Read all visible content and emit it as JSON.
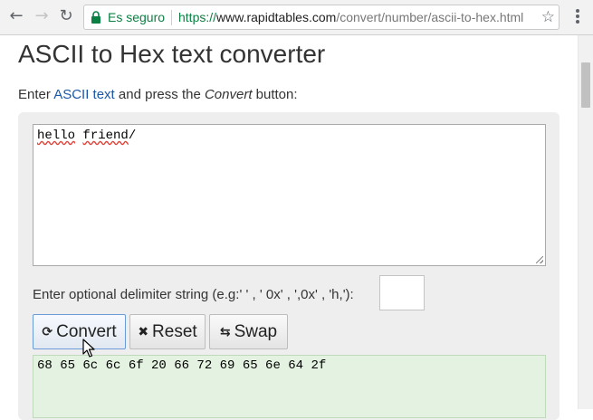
{
  "browser": {
    "back_icon": "arrow-left-icon",
    "forward_icon": "arrow-right-icon",
    "reload_icon": "reload-icon",
    "secure_label": "Es seguro",
    "url_scheme": "https://",
    "url_host": "www.rapidtables.com",
    "url_path": "/convert/number/ascii-to-hex.html",
    "star_icon": "star-icon",
    "menu_icon": "kebab-menu-icon"
  },
  "page": {
    "title": "ASCII to Hex text converter",
    "intro_prefix": "Enter ",
    "intro_link": "ASCII text",
    "intro_middle": " and press the ",
    "intro_em": "Convert",
    "intro_suffix": " button:",
    "input_word1": "hello",
    "input_space": " ",
    "input_word2": "friend",
    "input_tail": "/",
    "delimiter_label": "Enter optional delimiter string (e.g:' ' , ' 0x' , ',0x' , 'h,'):",
    "delimiter_value": "",
    "buttons": {
      "convert_label": "Convert",
      "reset_label": "Reset",
      "swap_label": "Swap"
    },
    "output_value": "68 65 6c 6c 6f 20 66 72 69 65 6e 64 2f"
  },
  "colors": {
    "secure": "#0b8043",
    "link": "#1a57a8",
    "output_bg": "#e4f2e1",
    "panel_bg": "#eeeeee"
  }
}
